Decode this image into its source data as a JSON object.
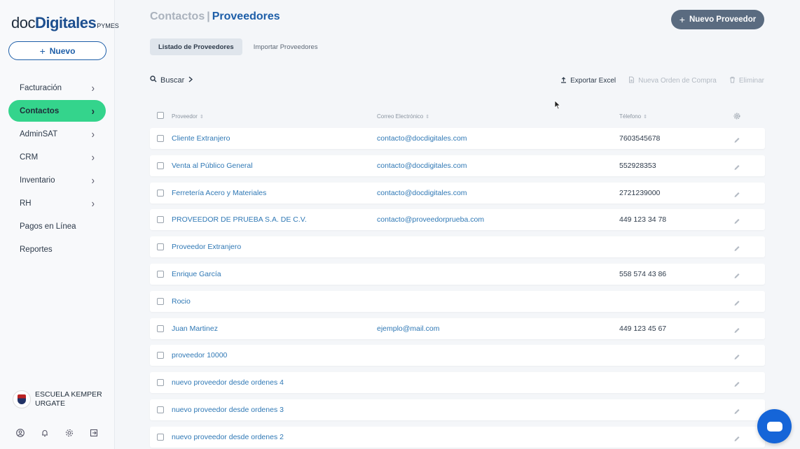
{
  "brand": {
    "doc": "doc",
    "digitales": "Digitales",
    "pymes": "PYMES"
  },
  "sidebar": {
    "new_label": "Nuevo",
    "items": [
      {
        "label": "Facturación",
        "chevron": true
      },
      {
        "label": "Contactos",
        "chevron": true,
        "active": true
      },
      {
        "label": "AdminSAT",
        "chevron": true
      },
      {
        "label": "CRM",
        "chevron": true
      },
      {
        "label": "Inventario",
        "chevron": true
      },
      {
        "label": "RH",
        "chevron": true
      },
      {
        "label": "Pagos en Línea",
        "chevron": false
      },
      {
        "label": "Reportes",
        "chevron": false
      }
    ],
    "user": {
      "name": "ESCUELA KEMPER URGATE"
    }
  },
  "header": {
    "breadcrumb_parent": "Contactos",
    "breadcrumb_sep": "|",
    "breadcrumb_current": "Proveedores",
    "add_button": "Nuevo Proveedor"
  },
  "tabs": [
    {
      "label": "Listado de Proveedores",
      "active": true
    },
    {
      "label": "Importar Proveedores",
      "active": false
    }
  ],
  "toolbar": {
    "search_label": "Buscar",
    "export_label": "Exportar Excel",
    "new_order_label": "Nueva Orden de Compra",
    "delete_label": "Eliminar"
  },
  "table": {
    "columns": {
      "name": "Proveedor",
      "email": "Correo Electrónico",
      "phone": "Télefono"
    },
    "rows": [
      {
        "name": "Cliente Extranjero",
        "email": "contacto@docdigitales.com",
        "phone": "7603545678"
      },
      {
        "name": "Venta al Público General",
        "email": "contacto@docdigitales.com",
        "phone": "552928353"
      },
      {
        "name": "Ferretería Acero y Materiales",
        "email": "contacto@docdigitales.com",
        "phone": "2721239000"
      },
      {
        "name": "PROVEEDOR DE PRUEBA S.A. DE C.V.",
        "email": "contacto@proveedorprueba.com",
        "phone": "449 123 34 78"
      },
      {
        "name": "Proveedor Extranjero",
        "email": "",
        "phone": ""
      },
      {
        "name": "Enrique García",
        "email": "",
        "phone": "558 574 43 86"
      },
      {
        "name": "Rocio",
        "email": "",
        "phone": ""
      },
      {
        "name": "Juan Martinez",
        "email": "ejemplo@mail.com",
        "phone": "449 123 45 67"
      },
      {
        "name": "proveedor 10000",
        "email": "",
        "phone": ""
      },
      {
        "name": "nuevo proveedor desde ordenes 4",
        "email": "",
        "phone": ""
      },
      {
        "name": "nuevo proveedor desde ordenes 3",
        "email": "",
        "phone": ""
      },
      {
        "name": "nuevo proveedor desde ordenes 2",
        "email": "",
        "phone": ""
      }
    ]
  },
  "colors": {
    "accent": "#34d48c",
    "brand_blue": "#1d5ea8",
    "link": "#2f78b5",
    "chat": "#1565d8"
  }
}
